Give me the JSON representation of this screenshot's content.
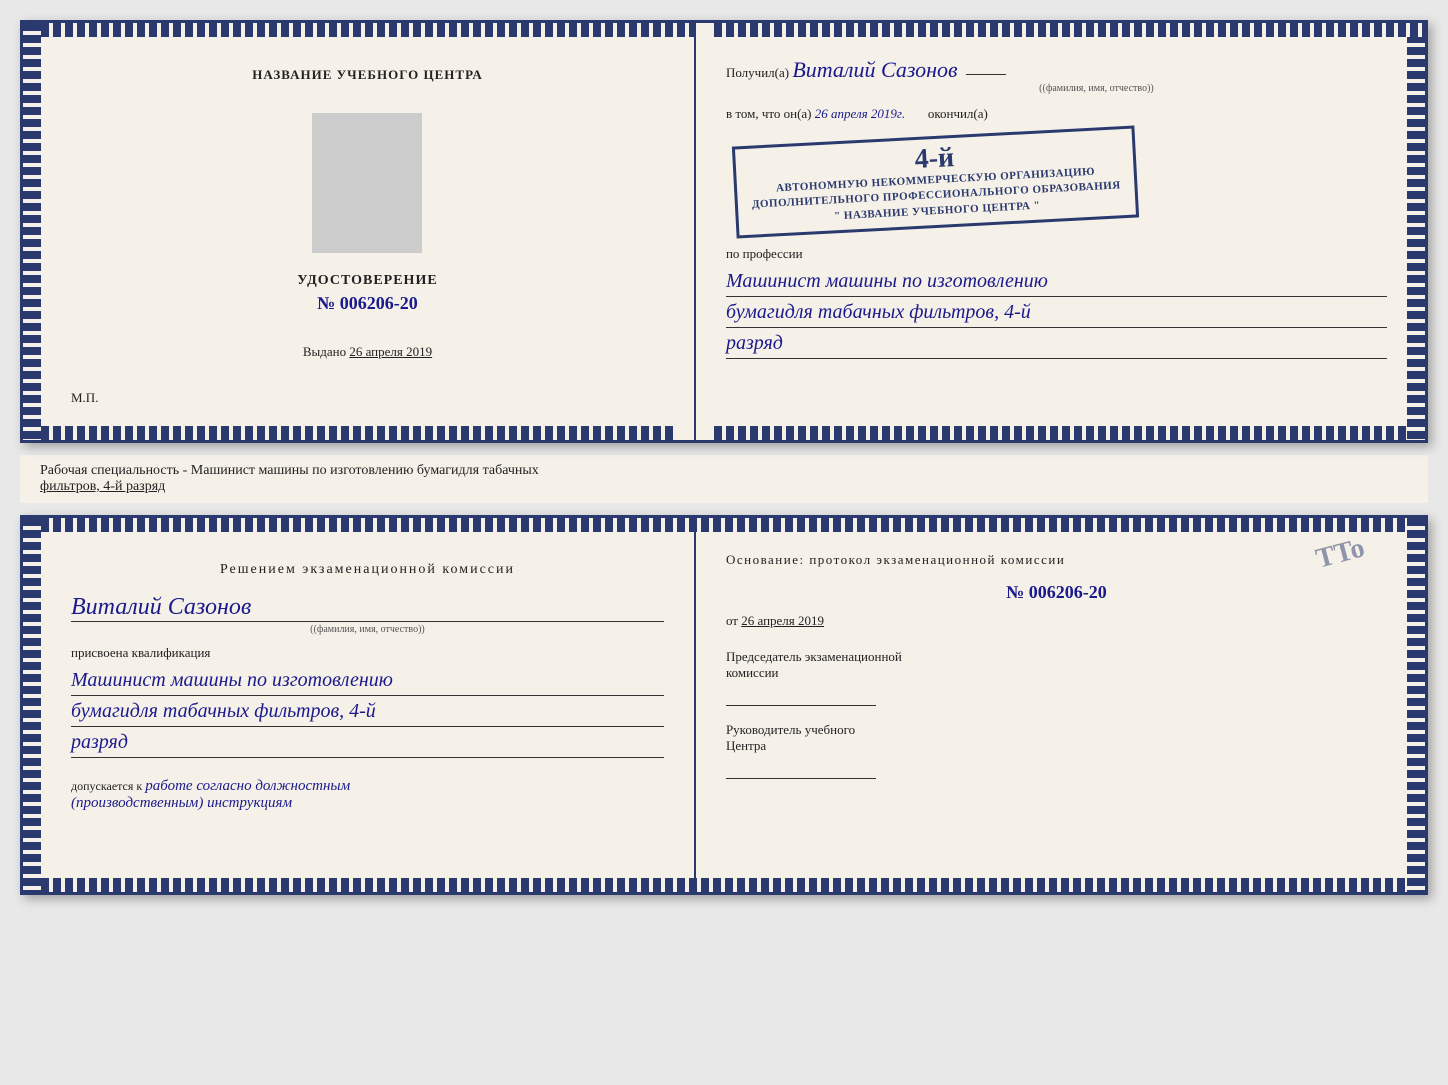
{
  "page": {
    "background": "#e8e8e8"
  },
  "top_booklet": {
    "left": {
      "center_title": "НАЗВАНИЕ УЧЕБНОГО ЦЕНТРА",
      "udostoverenie_label": "УДОСТОВЕРЕНИЕ",
      "udostoverenie_number": "№ 006206-20",
      "vydano_label": "Выдано",
      "vydano_date": "26 апреля 2019",
      "mp_label": "М.П."
    },
    "right": {
      "poluchil_label": "Получил(а)",
      "recipient_name": "Виталий Сазонов",
      "fio_subtitle": "(фамилия, имя, отчество)",
      "vtom_label": "в том, что он(а)",
      "date_value": "26 апреля 2019г.",
      "okonchil_label": "окончил(а)",
      "stamp_number": "4-й",
      "stamp_line1": "АВТОНОМНУЮ НЕКОММЕРЧЕСКУЮ ОРГАНИЗАЦИЮ",
      "stamp_line2": "ДОПОЛНИТЕЛЬНОГО ПРОФЕССИОНАЛЬНОГО ОБРАЗОВАНИЯ",
      "stamp_line3": "\" НАЗВАНИЕ УЧЕБНОГО ЦЕНТРА \"",
      "po_professii_label": "по профессии",
      "profession_line1": "Машинист машины по изготовлению",
      "profession_line2": "бумагидля табачных фильтров, 4-й",
      "profession_line3": "разряд"
    }
  },
  "middle_strip": {
    "text_before_underline": "Рабочая специальность - Машинист машины по изготовлению бумагидля табачных",
    "underline_text": "фильтров, 4-й разряд"
  },
  "bottom_booklet": {
    "left": {
      "resheniem_title": "Решением  экзаменационной  комиссии",
      "name_cursive": "Виталий Сазонов",
      "fio_subtitle": "(фамилия, имя, отчество)",
      "prisvoena_label": "присвоена квалификация",
      "qualification_line1": "Машинист машины по изготовлению",
      "qualification_line2": "бумагидля табачных фильтров, 4-й",
      "qualification_line3": "разряд",
      "dopuskaetsya_label": "допускается к",
      "dopuskaetsya_cursive": "работе согласно должностным",
      "dopuskaetsya_cursive2": "(производственным) инструкциям"
    },
    "right": {
      "osnovanie_label": "Основание: протокол экзаменационной  комиссии",
      "protocol_number": "№  006206-20",
      "ot_label": "от",
      "ot_date": "26 апреля 2019",
      "predsedatel_label": "Председатель экзаменационной",
      "predsedatel_label2": "комиссии",
      "rukovoditel_label": "Руководитель учебного",
      "rukovoditel_label2": "Центра"
    }
  },
  "tto_stamp": "TTo"
}
